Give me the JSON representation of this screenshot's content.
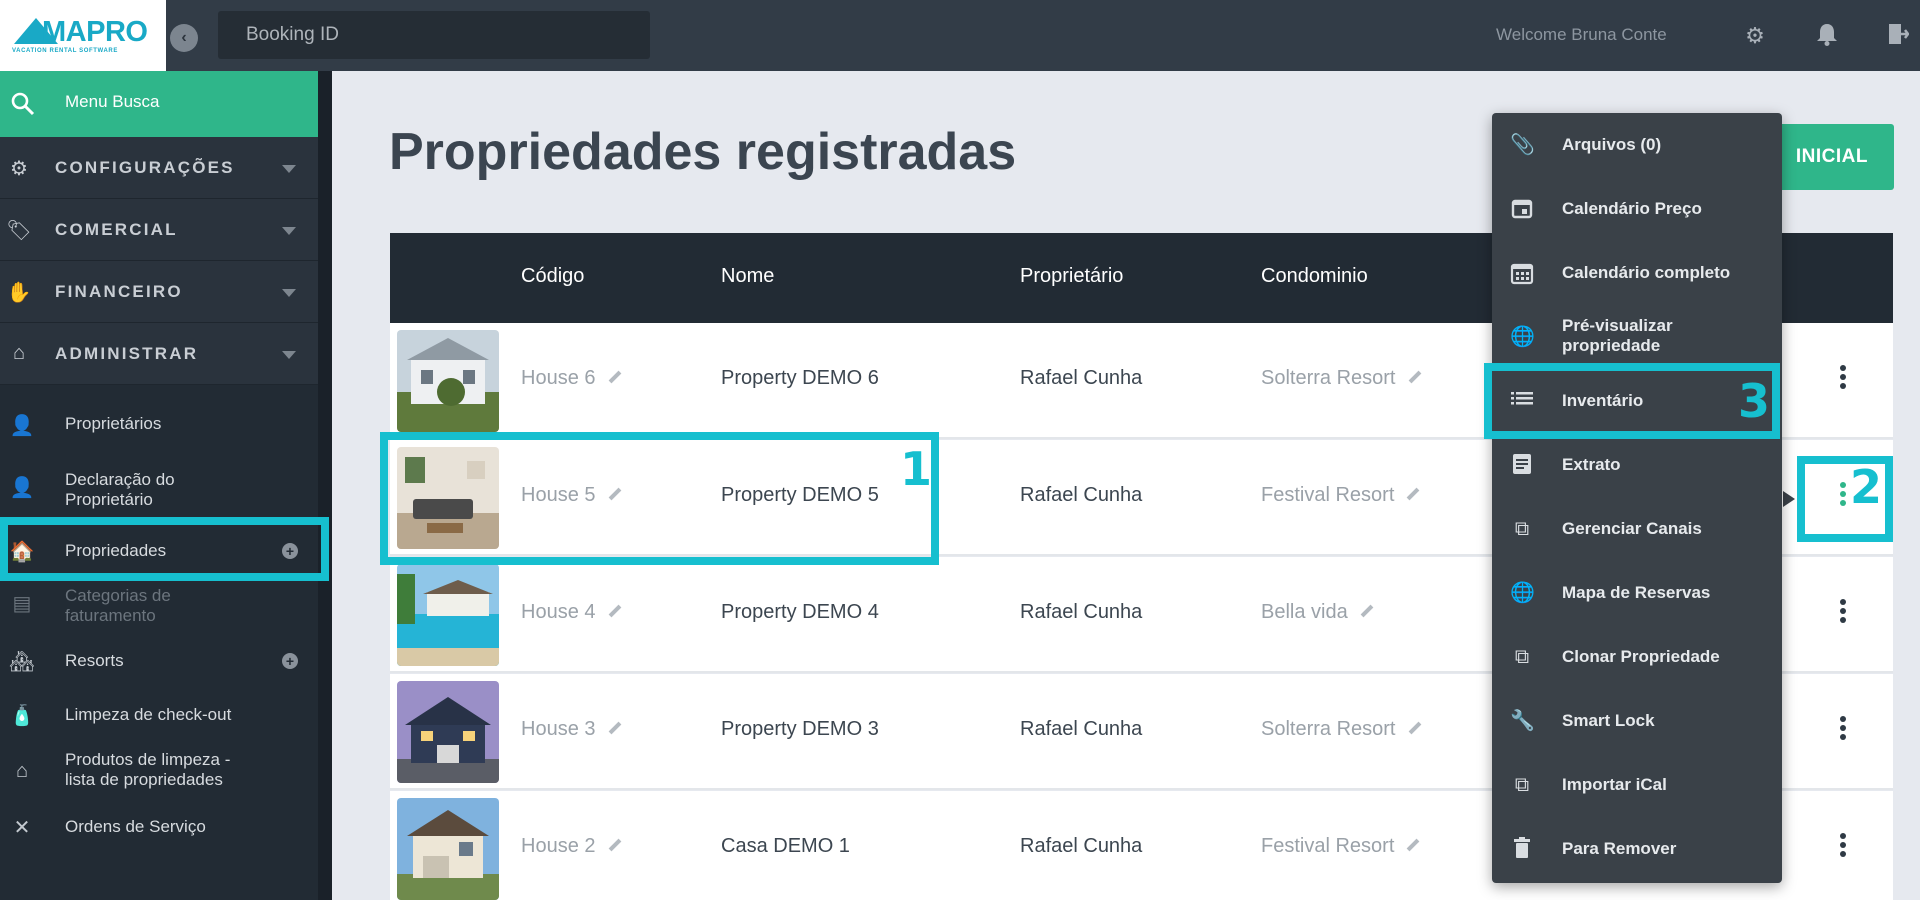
{
  "header": {
    "logo_text": "MAPRO",
    "logo_sub": "VACATION RENTAL SOFTWARE",
    "search_placeholder": "Booking ID",
    "welcome": "Welcome Bruna Conte"
  },
  "sidebar": {
    "menu_busca": "Menu Busca",
    "sections": [
      {
        "label": "CONFIGURAÇÕES"
      },
      {
        "label": "COMERCIAL"
      },
      {
        "label": "FINANCEIRO"
      },
      {
        "label": "ADMINISTRAR"
      }
    ],
    "items": [
      {
        "label": "Proprietários"
      },
      {
        "label": "Declaração do\nProprietário"
      },
      {
        "label": "Propriedades"
      },
      {
        "label": "Categorias de\nfaturamento"
      },
      {
        "label": "Resorts"
      },
      {
        "label": "Limpeza de check-out"
      },
      {
        "label": "Produtos de limpeza -\nlista de propriedades"
      },
      {
        "label": "Ordens de Serviço"
      }
    ]
  },
  "main": {
    "title": "Propriedades registradas",
    "green_button": "INICIAL",
    "columns": [
      "Código",
      "Nome",
      "Proprietário",
      "Condominio"
    ],
    "rows": [
      {
        "code": "House 6",
        "name": "Property DEMO 6",
        "owner": "Rafael Cunha",
        "condo": "Solterra Resort"
      },
      {
        "code": "House 5",
        "name": "Property DEMO 5",
        "owner": "Rafael Cunha",
        "condo": "Festival Resort"
      },
      {
        "code": "House 4",
        "name": "Property DEMO 4",
        "owner": "Rafael Cunha",
        "condo": "Bella vida"
      },
      {
        "code": "House 3",
        "name": "Property DEMO 3",
        "owner": "Rafael Cunha",
        "condo": "Solterra Resort"
      },
      {
        "code": "House 2",
        "name": "Casa DEMO 1",
        "owner": "Rafael Cunha",
        "condo": "Festival Resort"
      }
    ]
  },
  "dropdown": {
    "items": [
      {
        "label": "Arquivos (0)",
        "icon": "paperclip-icon"
      },
      {
        "label": "Calendário Preço",
        "icon": "calendar-day-icon"
      },
      {
        "label": "Calendário completo",
        "icon": "calendar-grid-icon"
      },
      {
        "label": "Pré-visualizar\npropriedade",
        "icon": "globe-icon"
      },
      {
        "label": "Inventário",
        "icon": "list-icon"
      },
      {
        "label": "Extrato",
        "icon": "document-icon"
      },
      {
        "label": "Gerenciar Canais",
        "icon": "copy-icon"
      },
      {
        "label": "Mapa de Reservas",
        "icon": "globe-icon"
      },
      {
        "label": "Clonar Propriedade",
        "icon": "copy-icon"
      },
      {
        "label": "Smart Lock",
        "icon": "wrench-icon"
      },
      {
        "label": "Importar iCal",
        "icon": "copy-icon"
      },
      {
        "label": "Para Remover",
        "icon": "trash-icon"
      }
    ]
  },
  "annotations": {
    "one": "1",
    "two": "2",
    "three": "3"
  },
  "colors": {
    "accent_green": "#2fb68a",
    "highlight": "#16bfcf",
    "dark": "#222b34"
  }
}
